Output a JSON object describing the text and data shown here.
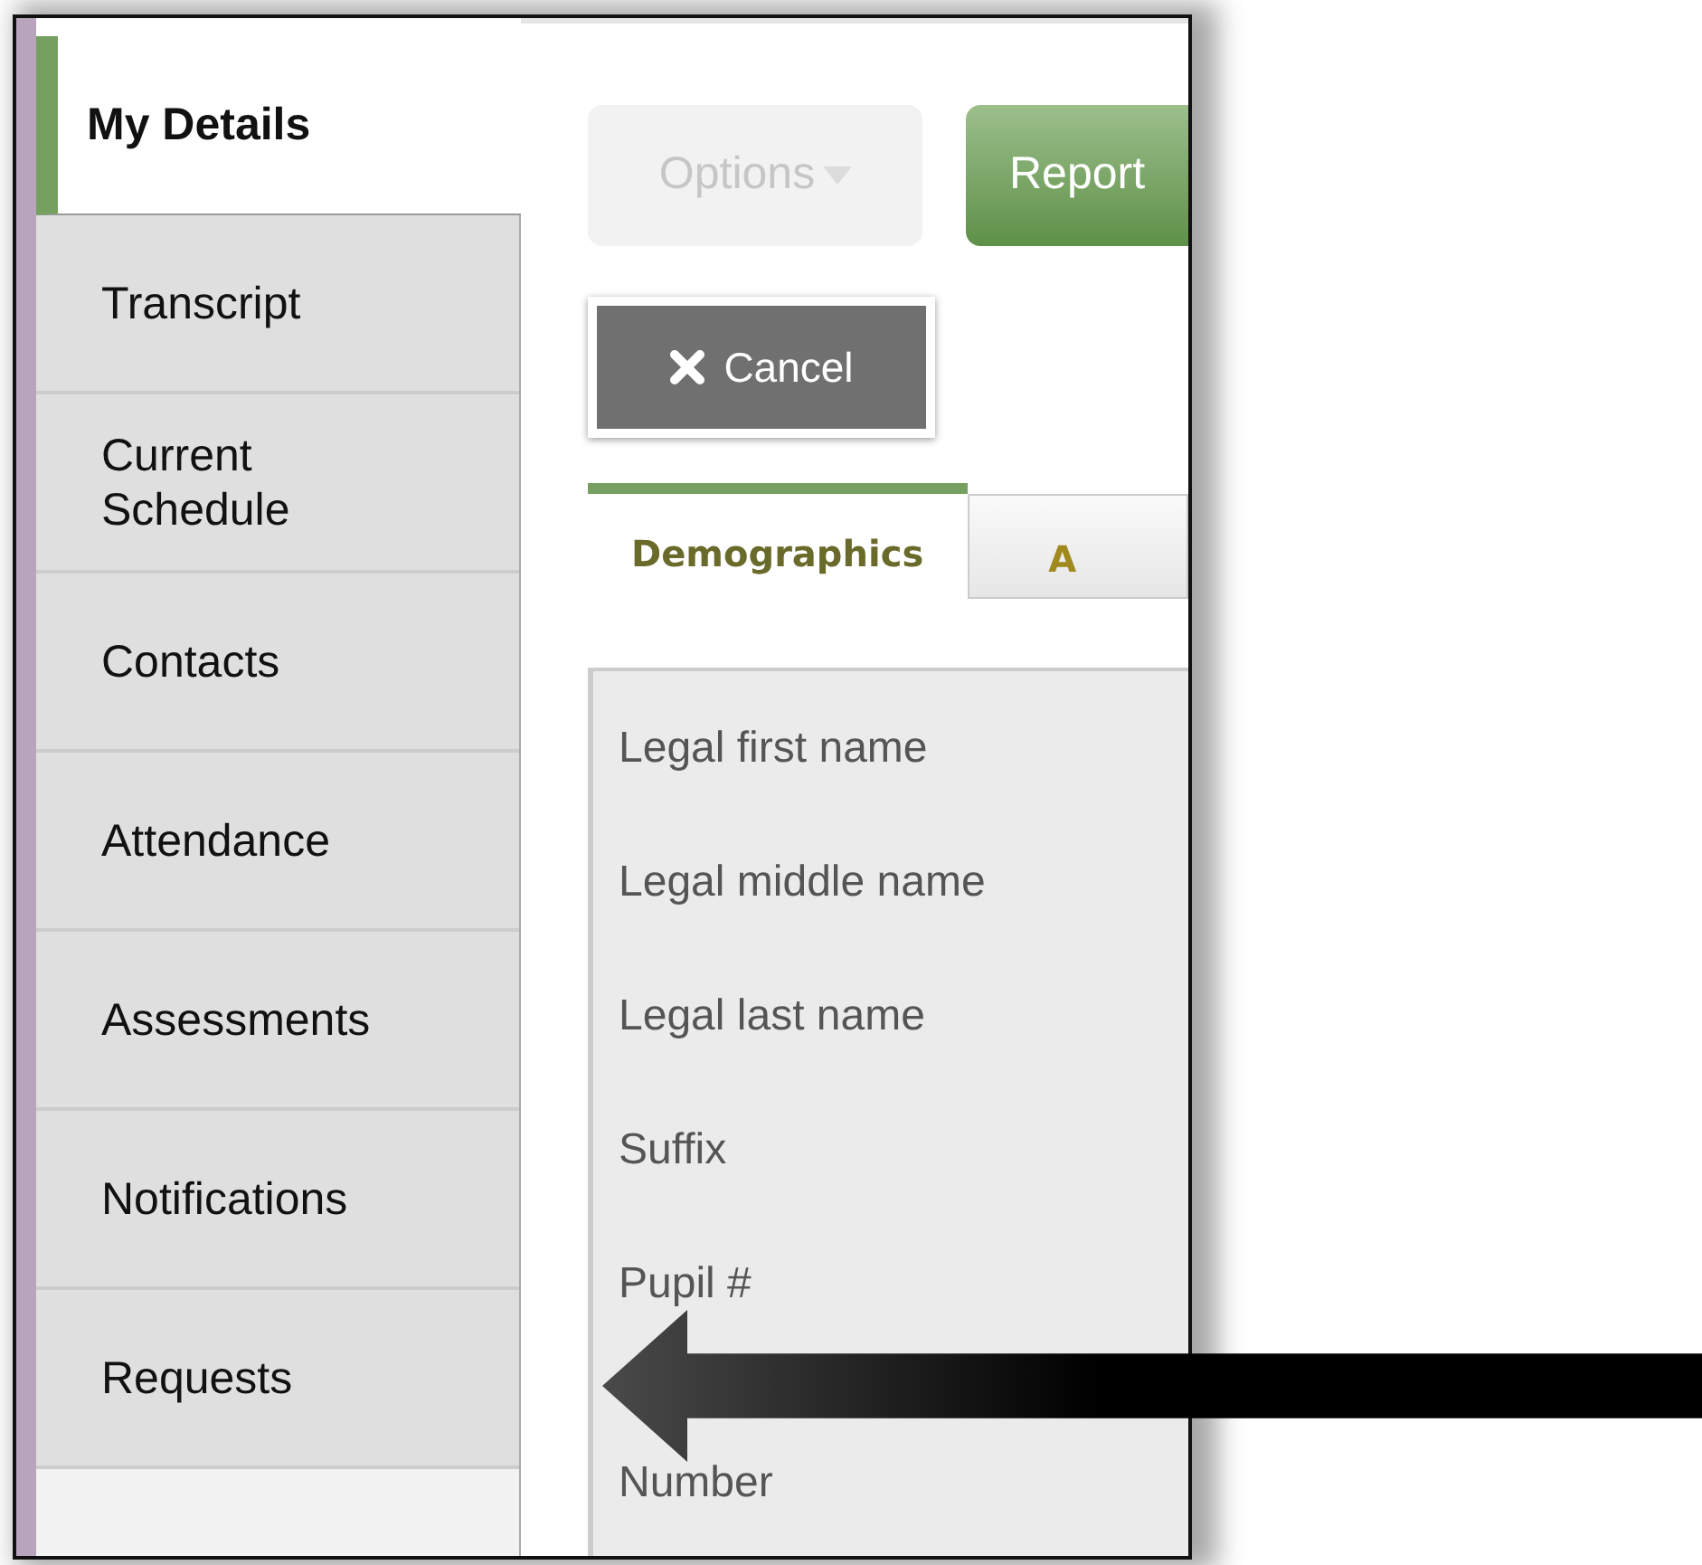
{
  "sidebar": {
    "items": [
      {
        "label": "My Details",
        "selected": true
      },
      {
        "label": "Transcript",
        "selected": false
      },
      {
        "label": "Current Schedule",
        "selected": false
      },
      {
        "label": "Contacts",
        "selected": false
      },
      {
        "label": "Attendance",
        "selected": false
      },
      {
        "label": "Assessments",
        "selected": false
      },
      {
        "label": "Notifications",
        "selected": false
      },
      {
        "label": "Requests",
        "selected": false
      }
    ]
  },
  "toolbar": {
    "options_button": {
      "label": "Options",
      "disabled": true
    },
    "reports_button": {
      "label": "Report"
    },
    "cancel_button": {
      "label": "Cancel"
    }
  },
  "tabs": [
    {
      "label": "Demographics",
      "selected": true
    },
    {
      "label": "A",
      "selected": false
    }
  ],
  "form": {
    "fields": [
      "Legal first name",
      "Legal middle name",
      "Legal last name",
      "Suffix",
      "Pupil #",
      "Number"
    ]
  }
}
